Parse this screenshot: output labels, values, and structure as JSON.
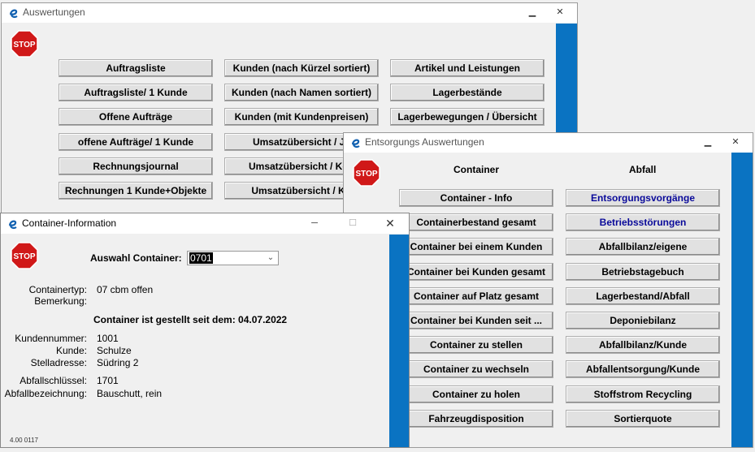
{
  "win1": {
    "title": "Auswertungen",
    "col1": [
      "Auftragsliste",
      "Auftragsliste/ 1 Kunde",
      "Offene Aufträge",
      "offene Aufträge/ 1 Kunde",
      "Rechnungsjournal",
      "Rechnungen 1 Kunde+Objekte"
    ],
    "col2": [
      "Kunden (nach Kürzel sortiert)",
      "Kunden (nach Namen sortiert)",
      "Kunden (mit Kundenpreisen)",
      "Umsatzübersicht / Ja",
      "Umsatzübersicht / Kon",
      "Umsatzübersicht / KS"
    ],
    "col3": [
      "Artikel und Leistungen",
      "Lagerbestände",
      "Lagerbewegungen / Übersicht"
    ],
    "stop_label": "STOP"
  },
  "win2": {
    "title": "Entsorgungs Auswertungen",
    "header_container": "Container",
    "header_abfall": "Abfall",
    "container_buttons": [
      "Container - Info",
      "Containerbestand gesamt",
      "Container bei einem Kunden",
      "Container bei Kunden gesamt",
      "Container auf Platz gesamt",
      "Container bei Kunden seit ...",
      "Container zu stellen",
      "Container zu wechseln",
      "Container zu holen",
      "Fahrzeugdisposition"
    ],
    "abfall_buttons": [
      "Entsorgungsvorgänge",
      "Betriebsstörungen",
      "Abfallbilanz/eigene",
      "Betriebstagebuch",
      "Lagerbestand/Abfall",
      "Deponiebilanz",
      "Abfallbilanz/Kunde",
      "Abfallentsorgung/Kunde",
      "Stoffstrom Recycling",
      "Sortierquote"
    ],
    "stop_label": "STOP"
  },
  "win3": {
    "title": "Container-Information",
    "auswahl_label": "Auswahl Container:",
    "auswahl_value": "0701",
    "containertyp_label": "Containertyp:",
    "containertyp_value": "07 cbm offen",
    "bemerkung_label": "Bemerkung:",
    "gestellt_text": "Container ist gestellt seit dem: 04.07.2022",
    "kundennummer_label": "Kundennummer:",
    "kundennummer_value": "1001",
    "kunde_label": "Kunde:",
    "kunde_value": "Schulze",
    "stelladresse_label": "Stelladresse:",
    "stelladresse_value": "Südring 2",
    "abfallschluessel_label": "Abfallschlüssel:",
    "abfallschluessel_value": "1701",
    "abfallbezeichnung_label": "Abfallbezeichnung:",
    "abfallbezeichnung_value": "Bauschutt, rein",
    "version": "4.00 0117",
    "stop_label": "STOP"
  },
  "colors": {
    "accent_blue": "#0a73c2",
    "stop_red": "#d01818",
    "link_blue": "#0a0a9a"
  },
  "icons": {
    "app": "e-logo-icon",
    "stop": "stop-sign-icon",
    "minimize": "minimize-icon",
    "maximize": "maximize-icon",
    "close": "close-icon"
  }
}
